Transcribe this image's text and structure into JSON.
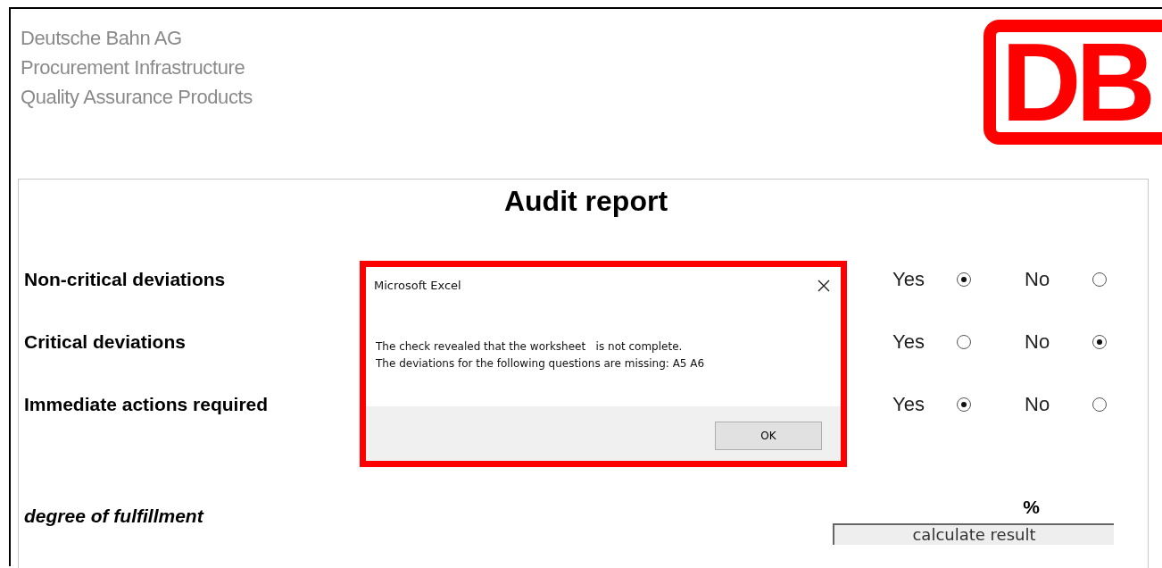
{
  "header": {
    "lines": [
      "Deutsche Bahn AG",
      "Procurement Infrastructure",
      "Quality Assurance Products"
    ],
    "logo": "DB"
  },
  "sheet": {
    "title": "Audit report",
    "questions": [
      {
        "label": "Non-critical deviations",
        "options": [
          {
            "label": "Yes",
            "selected": true
          },
          {
            "label": "No",
            "selected": false
          }
        ]
      },
      {
        "label": "Critical deviations",
        "options": [
          {
            "label": "Yes",
            "selected": false
          },
          {
            "label": "No",
            "selected": true
          }
        ]
      },
      {
        "label": "Immediate actions required",
        "options": [
          {
            "label": "Yes",
            "selected": true
          },
          {
            "label": "No",
            "selected": false
          }
        ]
      }
    ],
    "fulfillment": {
      "label": "degree of fulfillment",
      "unit": "%",
      "button": "calculate result"
    }
  },
  "dialog": {
    "title": "Microsoft Excel",
    "highlighted": true,
    "message": [
      "The check revealed that the worksheet   is not complete.",
      "The deviations for the following questions are missing: A5 A6"
    ],
    "button": "OK"
  }
}
